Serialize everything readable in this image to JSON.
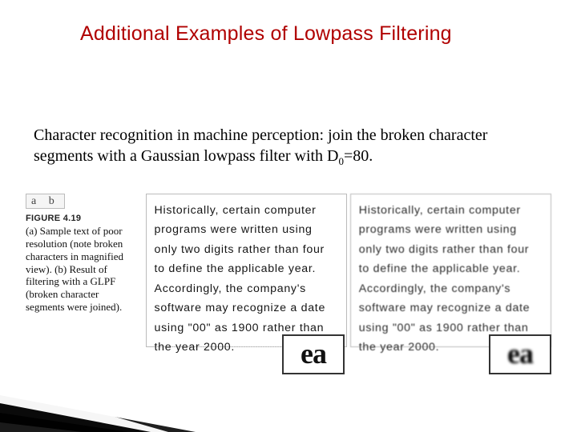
{
  "title": "Additional Examples of Lowpass Filtering",
  "body": "Character recognition in machine perception: join the broken character segments with a Gaussian lowpass filter with D",
  "body_sub": "0",
  "body_tail": "=80.",
  "figure": {
    "ab_label": "a  b",
    "label": "FIGURE 4.19",
    "caption": "(a) Sample text of poor resolution (note broken characters in magnified view). (b) Result of filtering with a GLPF (broken character segments were joined).",
    "paragraph": "Historically, certain computer programs were written using only two digits rather than four to define the applicable year. Accordingly, the company's software may recognize a date using \"00\" as 1900 rather than the year 2000.",
    "mag_glyph": "ea"
  }
}
